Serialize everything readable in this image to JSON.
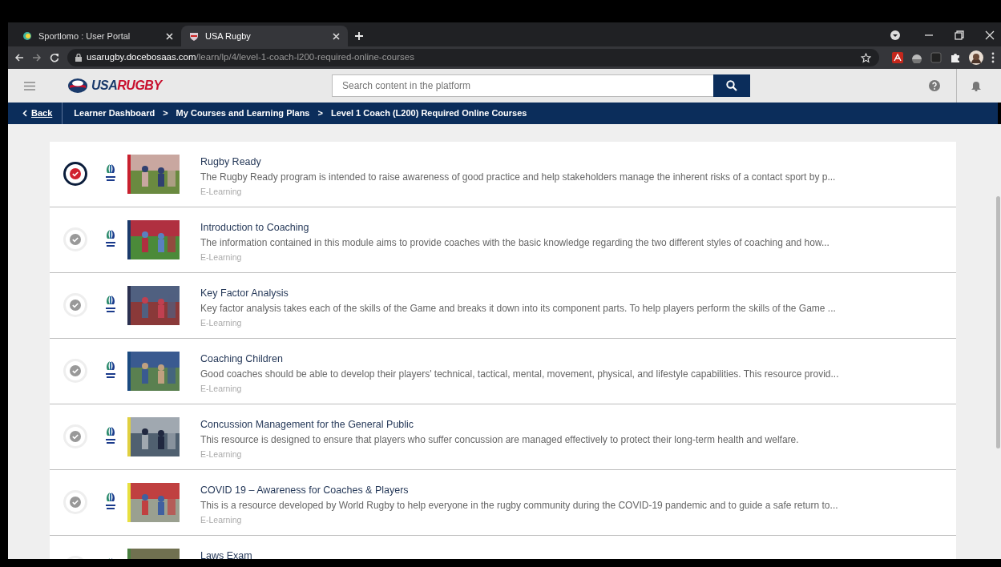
{
  "browser": {
    "tabs": [
      {
        "label": "Sportlomo : User Portal",
        "selected": false
      },
      {
        "label": "USA Rugby",
        "selected": true
      }
    ],
    "address": {
      "host": "usarugby.docebosaas.com",
      "path": "/learn/lp/4/level-1-coach-l200-required-online-courses"
    }
  },
  "header": {
    "logo": {
      "part1": "USA",
      "part2": "RUGBY"
    },
    "search": {
      "placeholder": "Search content in the platform"
    }
  },
  "breadcrumb": {
    "back": "Back",
    "items": [
      "Learner Dashboard",
      "My Courses and Learning Plans",
      "Level 1 Coach (L200) Required Online Courses"
    ],
    "separator": ">"
  },
  "courses": [
    {
      "title": "Rugby Ready",
      "description": "The Rugby Ready program is intended to raise awareness of good practice and help stakeholders manage the inherent risks of a contact sport by p...",
      "type": "E-Learning",
      "completed": true
    },
    {
      "title": "Introduction to Coaching",
      "description": "The information contained in this module aims to provide coaches with the basic knowledge regarding the two different styles of coaching and how...",
      "type": "E-Learning",
      "completed": false
    },
    {
      "title": "Key Factor Analysis",
      "description": "Key factor analysis takes each of the skills of the Game and breaks it down into its component parts. To help players perform the skills of the Game ...",
      "type": "E-Learning",
      "completed": false
    },
    {
      "title": "Coaching Children",
      "description": "Good coaches should be able to develop their players' technical, tactical, mental, movement, physical, and lifestyle capabilities. This resource provid...",
      "type": "E-Learning",
      "completed": false
    },
    {
      "title": "Concussion Management for the General Public",
      "description": "This resource is designed to ensure that players who suffer concussion are managed effectively to protect their long-term health and welfare.",
      "type": "E-Learning",
      "completed": false
    },
    {
      "title": "COVID 19 – Awareness for Coaches & Players",
      "description": "This is a resource developed by World Rugby to help everyone in the rugby community during the COVID-19 pandemic and to guide a safe return to...",
      "type": "E-Learning",
      "completed": false
    },
    {
      "title": "Laws Exam",
      "completed": false
    }
  ]
}
